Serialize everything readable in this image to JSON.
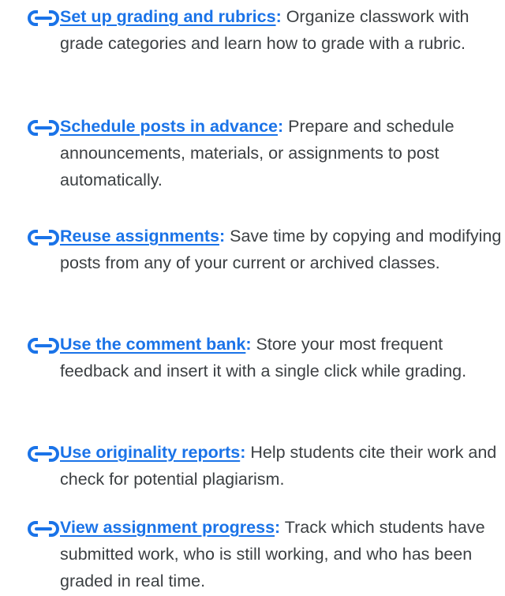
{
  "colors": {
    "link": "#1a73e8",
    "text": "#3c4043",
    "icon": "#1a73e8"
  },
  "items": [
    {
      "icon": "link-icon",
      "title": "Set up grading and rubrics",
      "colon": ":",
      "description": " Organize classwork with grade categories and learn how to grade with a rubric."
    },
    {
      "icon": "link-icon",
      "title": "Schedule posts in advance",
      "colon": ":",
      "description": " Prepare and schedule announcements, materials, or assignments to post automatically."
    },
    {
      "icon": "link-icon",
      "title": "Reuse assignments",
      "colon": ":",
      "description": " Save time by copying and modifying posts from any of your current or archived classes."
    },
    {
      "icon": "link-icon",
      "title": "Use the comment bank",
      "colon": ":",
      "description": " Store your most frequent feedback and insert it with a single click while grading."
    },
    {
      "icon": "link-icon",
      "title": "Use originality reports",
      "colon": ":",
      "description": " Help students cite their work and check for potential plagiarism."
    },
    {
      "icon": "link-icon",
      "title": "View assignment progress",
      "colon": ":",
      "description": " Track which students have submitted work, who is still working, and who has been graded in real time."
    }
  ]
}
